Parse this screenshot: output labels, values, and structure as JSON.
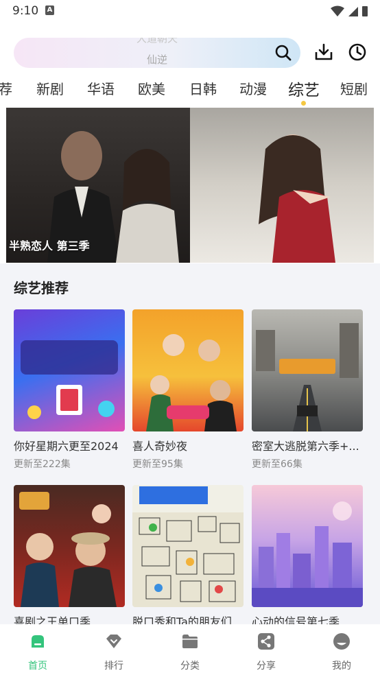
{
  "status_bar": {
    "time": "9:10"
  },
  "search": {
    "hint_previous": "大道朝天",
    "hint_current": "仙逆"
  },
  "tabs": [
    {
      "label": "荐"
    },
    {
      "label": "新剧"
    },
    {
      "label": "华语"
    },
    {
      "label": "欧美"
    },
    {
      "label": "日韩"
    },
    {
      "label": "动漫"
    },
    {
      "label": "综艺",
      "active": true
    },
    {
      "label": "短剧"
    }
  ],
  "banner": {
    "title": "半熟恋人 第三季"
  },
  "section": {
    "title": "综艺推荐"
  },
  "cards": [
    {
      "name": "你好星期六更至2024",
      "update": "更新至222集"
    },
    {
      "name": "喜人奇妙夜",
      "update": "更新至95集"
    },
    {
      "name": "密室大逃脱第六季+...",
      "update": "更新至66集"
    },
    {
      "name": "喜剧之王单口季",
      "update": ""
    },
    {
      "name": "脱口秀和Ta的朋友们",
      "update": ""
    },
    {
      "name": "心动的信号第七季",
      "update": ""
    }
  ],
  "bottom_nav": [
    {
      "label": "首页",
      "icon": "home-icon",
      "active": true
    },
    {
      "label": "排行",
      "icon": "ranking-icon"
    },
    {
      "label": "分类",
      "icon": "category-folder-icon"
    },
    {
      "label": "分享",
      "icon": "share-icon"
    },
    {
      "label": "我的",
      "icon": "profile-icon"
    }
  ],
  "colors": {
    "accent": "#34c47c",
    "tab_indicator": "#f5c842",
    "content_bg": "#f3f4f8"
  }
}
